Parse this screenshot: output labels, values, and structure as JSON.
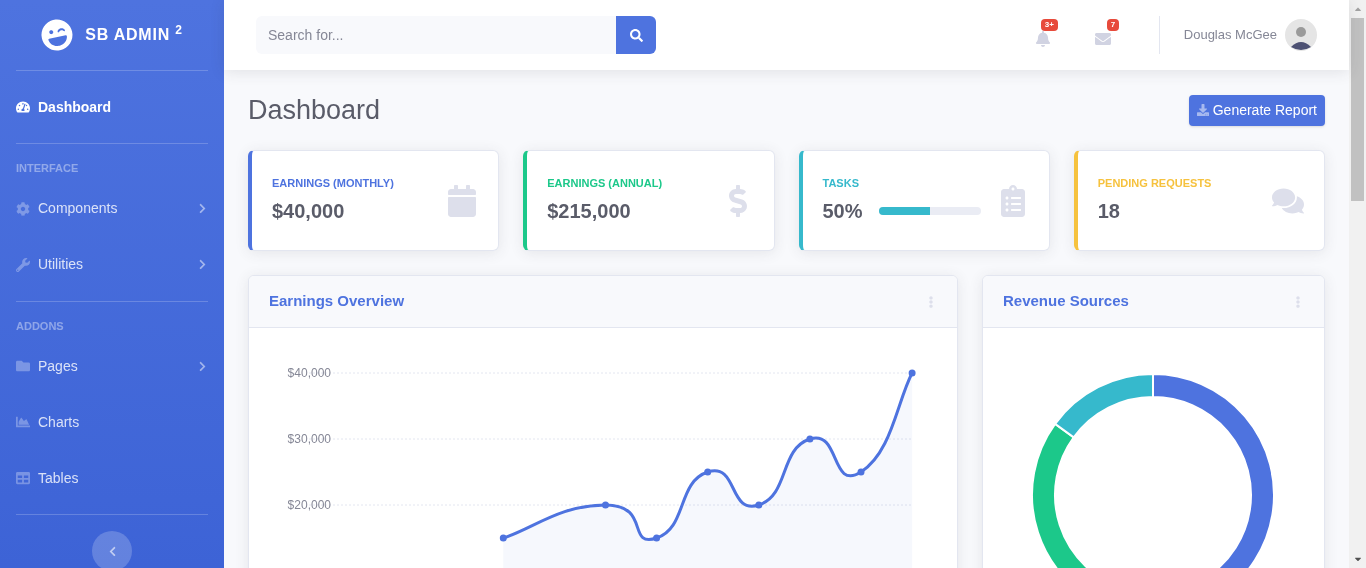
{
  "sidebar": {
    "brand": "SB ADMIN $^{2}$",
    "groups": [
      {
        "items": [
          {
            "label": "Dashboard",
            "selected": true,
            "submenu": false
          }
        ]
      },
      {
        "heading": "INTERFACE",
        "items": [
          {
            "label": "Components",
            "selected": false,
            "submenu": true
          },
          {
            "label": "Utilities",
            "selected": false,
            "submenu": true
          }
        ]
      },
      {
        "heading": "ADDONS",
        "items": [
          {
            "label": "Pages",
            "selected": false,
            "submenu": true
          },
          {
            "label": "Charts",
            "selected": false,
            "submenu": false
          },
          {
            "label": "Tables",
            "selected": false,
            "submenu": false
          }
        ]
      }
    ]
  },
  "topbar": {
    "search": {
      "placeholder": "Search for..."
    },
    "alerts_badge": "3+",
    "messages_badge": "7",
    "user_name": "Douglas McGee"
  },
  "page": {
    "title": "Dashboard",
    "action_button": "Generate Report"
  },
  "stat_cards": [
    {
      "label": "EARNINGS (MONTHLY)",
      "value": "$40,000",
      "color": "#4e73df"
    },
    {
      "label": "EARNINGS (ANNUAL)",
      "value": "$215,000",
      "color": "#1cc88a"
    },
    {
      "label": "TASKS",
      "value": "50%",
      "color": "#36b9cc",
      "level": 0.5
    },
    {
      "label": "PENDING REQUESTS",
      "value": "18",
      "color": "#f6c23e"
    }
  ],
  "earnings_overview": {
    "title": "Earnings Overview",
    "chart_data": {
      "type": "area",
      "ylim": [
        0,
        40000
      ],
      "yticks": [
        {
          "value": 20000,
          "label": "$20,000"
        },
        {
          "value": 30000,
          "label": "$30,000"
        },
        {
          "value": 40000,
          "label": "$40,000"
        }
      ],
      "series": [
        {
          "color": "#4e73df",
          "values": [
            null,
            null,
            null,
            15000,
            null,
            20000,
            15000,
            25000,
            20000,
            30000,
            25000,
            40000
          ]
        }
      ]
    }
  },
  "revenue_sources": {
    "title": "Revenue Sources",
    "chart_data": {
      "type": "donut",
      "values": [
        55,
        30,
        15
      ],
      "colors": [
        "#4e73df",
        "#1cc88a",
        "#36b9cc"
      ]
    }
  }
}
